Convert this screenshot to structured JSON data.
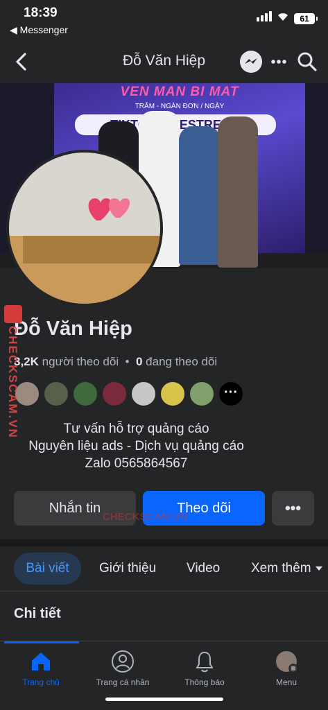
{
  "status_bar": {
    "time": "18:39",
    "back_app": "◀ Messenger",
    "battery": "61"
  },
  "nav": {
    "title": "Đỗ Văn Hiệp"
  },
  "cover": {
    "banner_title": "VEN MAN BI MAT",
    "banner_sub": "TRĂM - NGÀN ĐƠN / NGÀY",
    "banner_band": "TIKTOK LIVESTREAM"
  },
  "profile": {
    "name": "Đỗ Văn Hiệp",
    "followers_count": "3,2K",
    "followers_label": "người theo dõi",
    "following_count": "0",
    "following_label": "đang theo dõi",
    "bio_lines": [
      "Tư vấn hỗ trợ quảng cáo",
      "Nguyên liệu ads - Dịch vụ quảng cáo",
      "Zalo 0565864567"
    ]
  },
  "actions": {
    "message": "Nhắn tin",
    "follow": "Theo dõi",
    "more": "•••"
  },
  "tabs": [
    "Bài viết",
    "Giới thiệu",
    "Video",
    "Xem thêm"
  ],
  "section_title": "Chi tiết",
  "bottom_nav": [
    "Trang chủ",
    "Trang cá nhân",
    "Thông báo",
    "Menu"
  ],
  "watermark": {
    "side": "CHECKSCAM.VN",
    "center": "CHECKSCAM.VN"
  },
  "colors": {
    "accent": "#0866ff",
    "background": "#242526",
    "button": "#3a3b3c"
  }
}
